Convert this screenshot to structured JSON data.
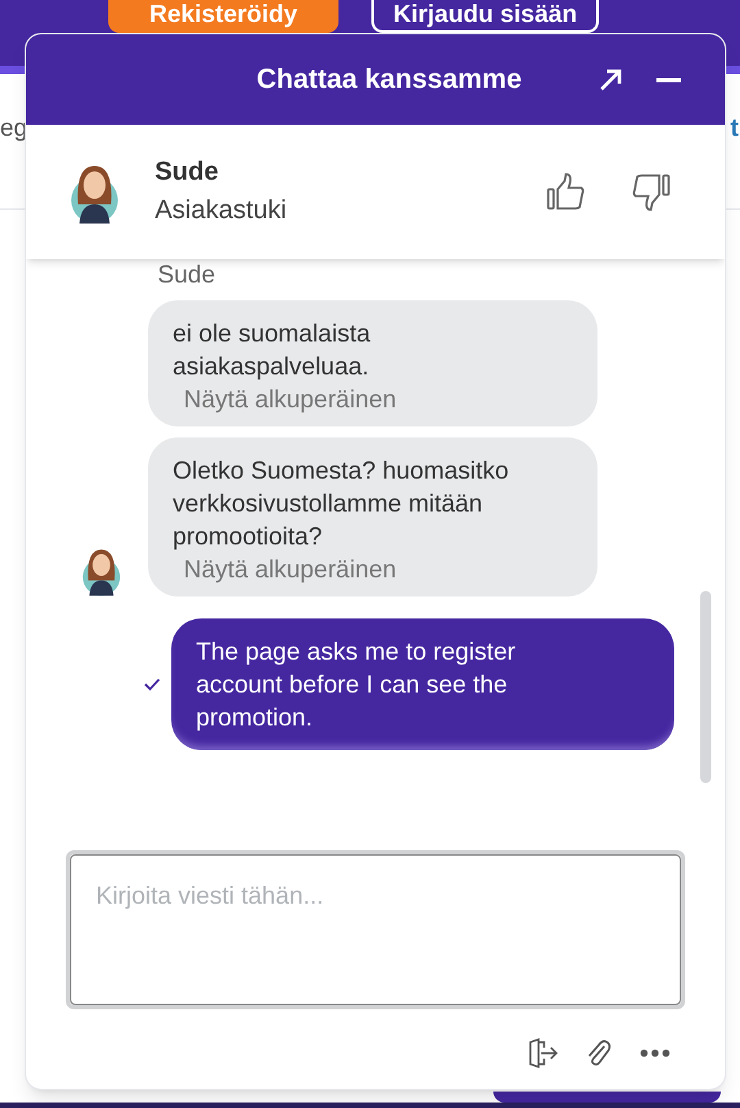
{
  "page": {
    "buttons": [
      {
        "label": "Rekisteröidy",
        "kind": "primary"
      },
      {
        "label": "Kirjaudu sisään",
        "kind": "outline"
      }
    ],
    "fragments": [
      "eg",
      "t"
    ]
  },
  "chat": {
    "title": "Chattaa kanssamme",
    "agent": {
      "name": "Sude",
      "role": "Asiakastuki"
    },
    "messages": [
      {
        "kind": "incoming",
        "author": "Sude",
        "text": "ei ole suomalaista asiakaspalveluaa.",
        "link": "Näytä alkuperäinen",
        "show_avatar": false
      },
      {
        "kind": "incoming",
        "text": "Oletko Suomesta? huomasitko verkkosivustollamme mitään promootioita?",
        "link": "Näytä alkuperäinen",
        "show_avatar": true
      },
      {
        "kind": "outgoing",
        "text": "The page asks me to register account before I can see the promotion.",
        "delivered": true
      }
    ],
    "input": {
      "placeholder": "Kirjoita viesti tähän..."
    }
  }
}
